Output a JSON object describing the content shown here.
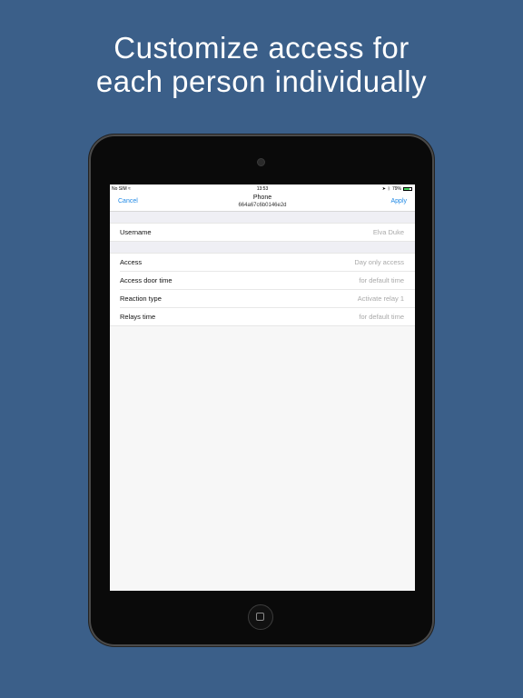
{
  "headline": {
    "line1": "Customize access for",
    "line2": "each person individually"
  },
  "status_bar": {
    "carrier": "No SIM",
    "wifi_icon": "wifi-icon",
    "time": "13:53",
    "battery_text": "79%",
    "battery_level": 0.79,
    "battery_color": "#4cd964"
  },
  "nav": {
    "cancel_label": "Cancel",
    "title": "Phone",
    "subtitle": "664a67c6b0146e2d",
    "apply_label": "Apply",
    "accent_color": "#1e88e5"
  },
  "user_section": {
    "rows": [
      {
        "label": "Username",
        "value": "Elva Duke"
      }
    ]
  },
  "settings_section": {
    "rows": [
      {
        "label": "Access",
        "value": "Day only access"
      },
      {
        "label": "Access door time",
        "value": "for default time"
      },
      {
        "label": "Reaction type",
        "value": "Activate relay 1"
      },
      {
        "label": "Relays time",
        "value": "for default time"
      }
    ]
  },
  "colors": {
    "background": "#3b5f89",
    "device": "#0a0a0a",
    "placeholder_text": "#a9a9a9"
  }
}
